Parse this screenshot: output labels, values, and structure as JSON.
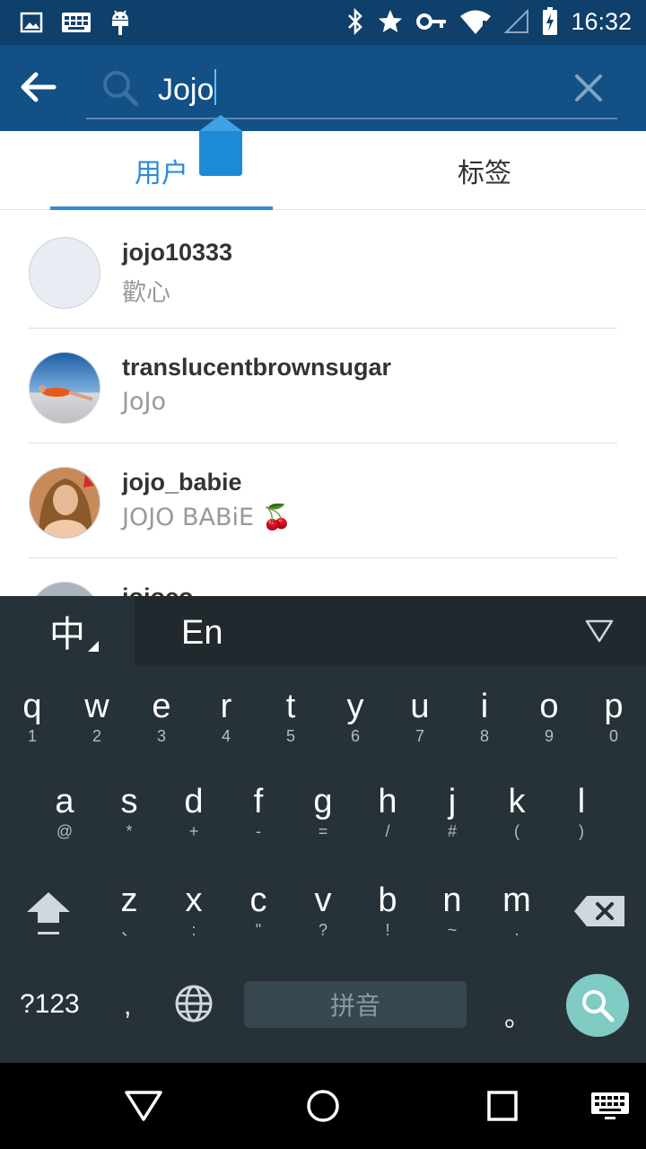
{
  "status_bar": {
    "time": "16:32",
    "left_icons": [
      "gallery-icon",
      "keyboard-icon",
      "android-debug-icon"
    ],
    "right_icons": [
      "bluetooth-icon",
      "star-icon",
      "vpn-key-icon",
      "wifi-icon",
      "cellular-icon",
      "battery-charging-icon"
    ]
  },
  "search": {
    "query": "Jojo",
    "placeholder": ""
  },
  "tabs": [
    {
      "label": "用户",
      "active": true
    },
    {
      "label": "标签",
      "active": false
    }
  ],
  "results": [
    {
      "username": "jojo10333",
      "full_name": "歡心"
    },
    {
      "username": "translucentbrownsugar",
      "full_name": "JoJo"
    },
    {
      "username": "jojo_babie",
      "full_name": "JOJO BABiE 🍒"
    },
    {
      "username": "jojoco",
      "full_name": ""
    }
  ],
  "keyboard": {
    "lang_cn": "中",
    "lang_en": "En",
    "row1": [
      {
        "k": "q",
        "s": "1"
      },
      {
        "k": "w",
        "s": "2"
      },
      {
        "k": "e",
        "s": "3"
      },
      {
        "k": "r",
        "s": "4"
      },
      {
        "k": "t",
        "s": "5"
      },
      {
        "k": "y",
        "s": "6"
      },
      {
        "k": "u",
        "s": "7"
      },
      {
        "k": "i",
        "s": "8"
      },
      {
        "k": "o",
        "s": "9"
      },
      {
        "k": "p",
        "s": "0"
      }
    ],
    "row2": [
      {
        "k": "a",
        "s": "@"
      },
      {
        "k": "s",
        "s": "*"
      },
      {
        "k": "d",
        "s": "+"
      },
      {
        "k": "f",
        "s": "-"
      },
      {
        "k": "g",
        "s": "="
      },
      {
        "k": "h",
        "s": "/"
      },
      {
        "k": "j",
        "s": "#"
      },
      {
        "k": "k",
        "s": "("
      },
      {
        "k": "l",
        "s": ")"
      }
    ],
    "row3": [
      {
        "k": "z",
        "s": "、"
      },
      {
        "k": "x",
        "s": ":"
      },
      {
        "k": "c",
        "s": "\""
      },
      {
        "k": "v",
        "s": "?"
      },
      {
        "k": "b",
        "s": "!"
      },
      {
        "k": "n",
        "s": "~"
      },
      {
        "k": "m",
        "s": "."
      }
    ],
    "symbols_key": "?123",
    "comma_key": ",",
    "space_label": "拼音",
    "period_key": "。"
  },
  "colors": {
    "status_bar": "#0f3f6b",
    "app_bar": "#125085",
    "accent": "#2f8ad9",
    "keyboard_bg": "#263238",
    "search_key": "#80cbc4"
  }
}
